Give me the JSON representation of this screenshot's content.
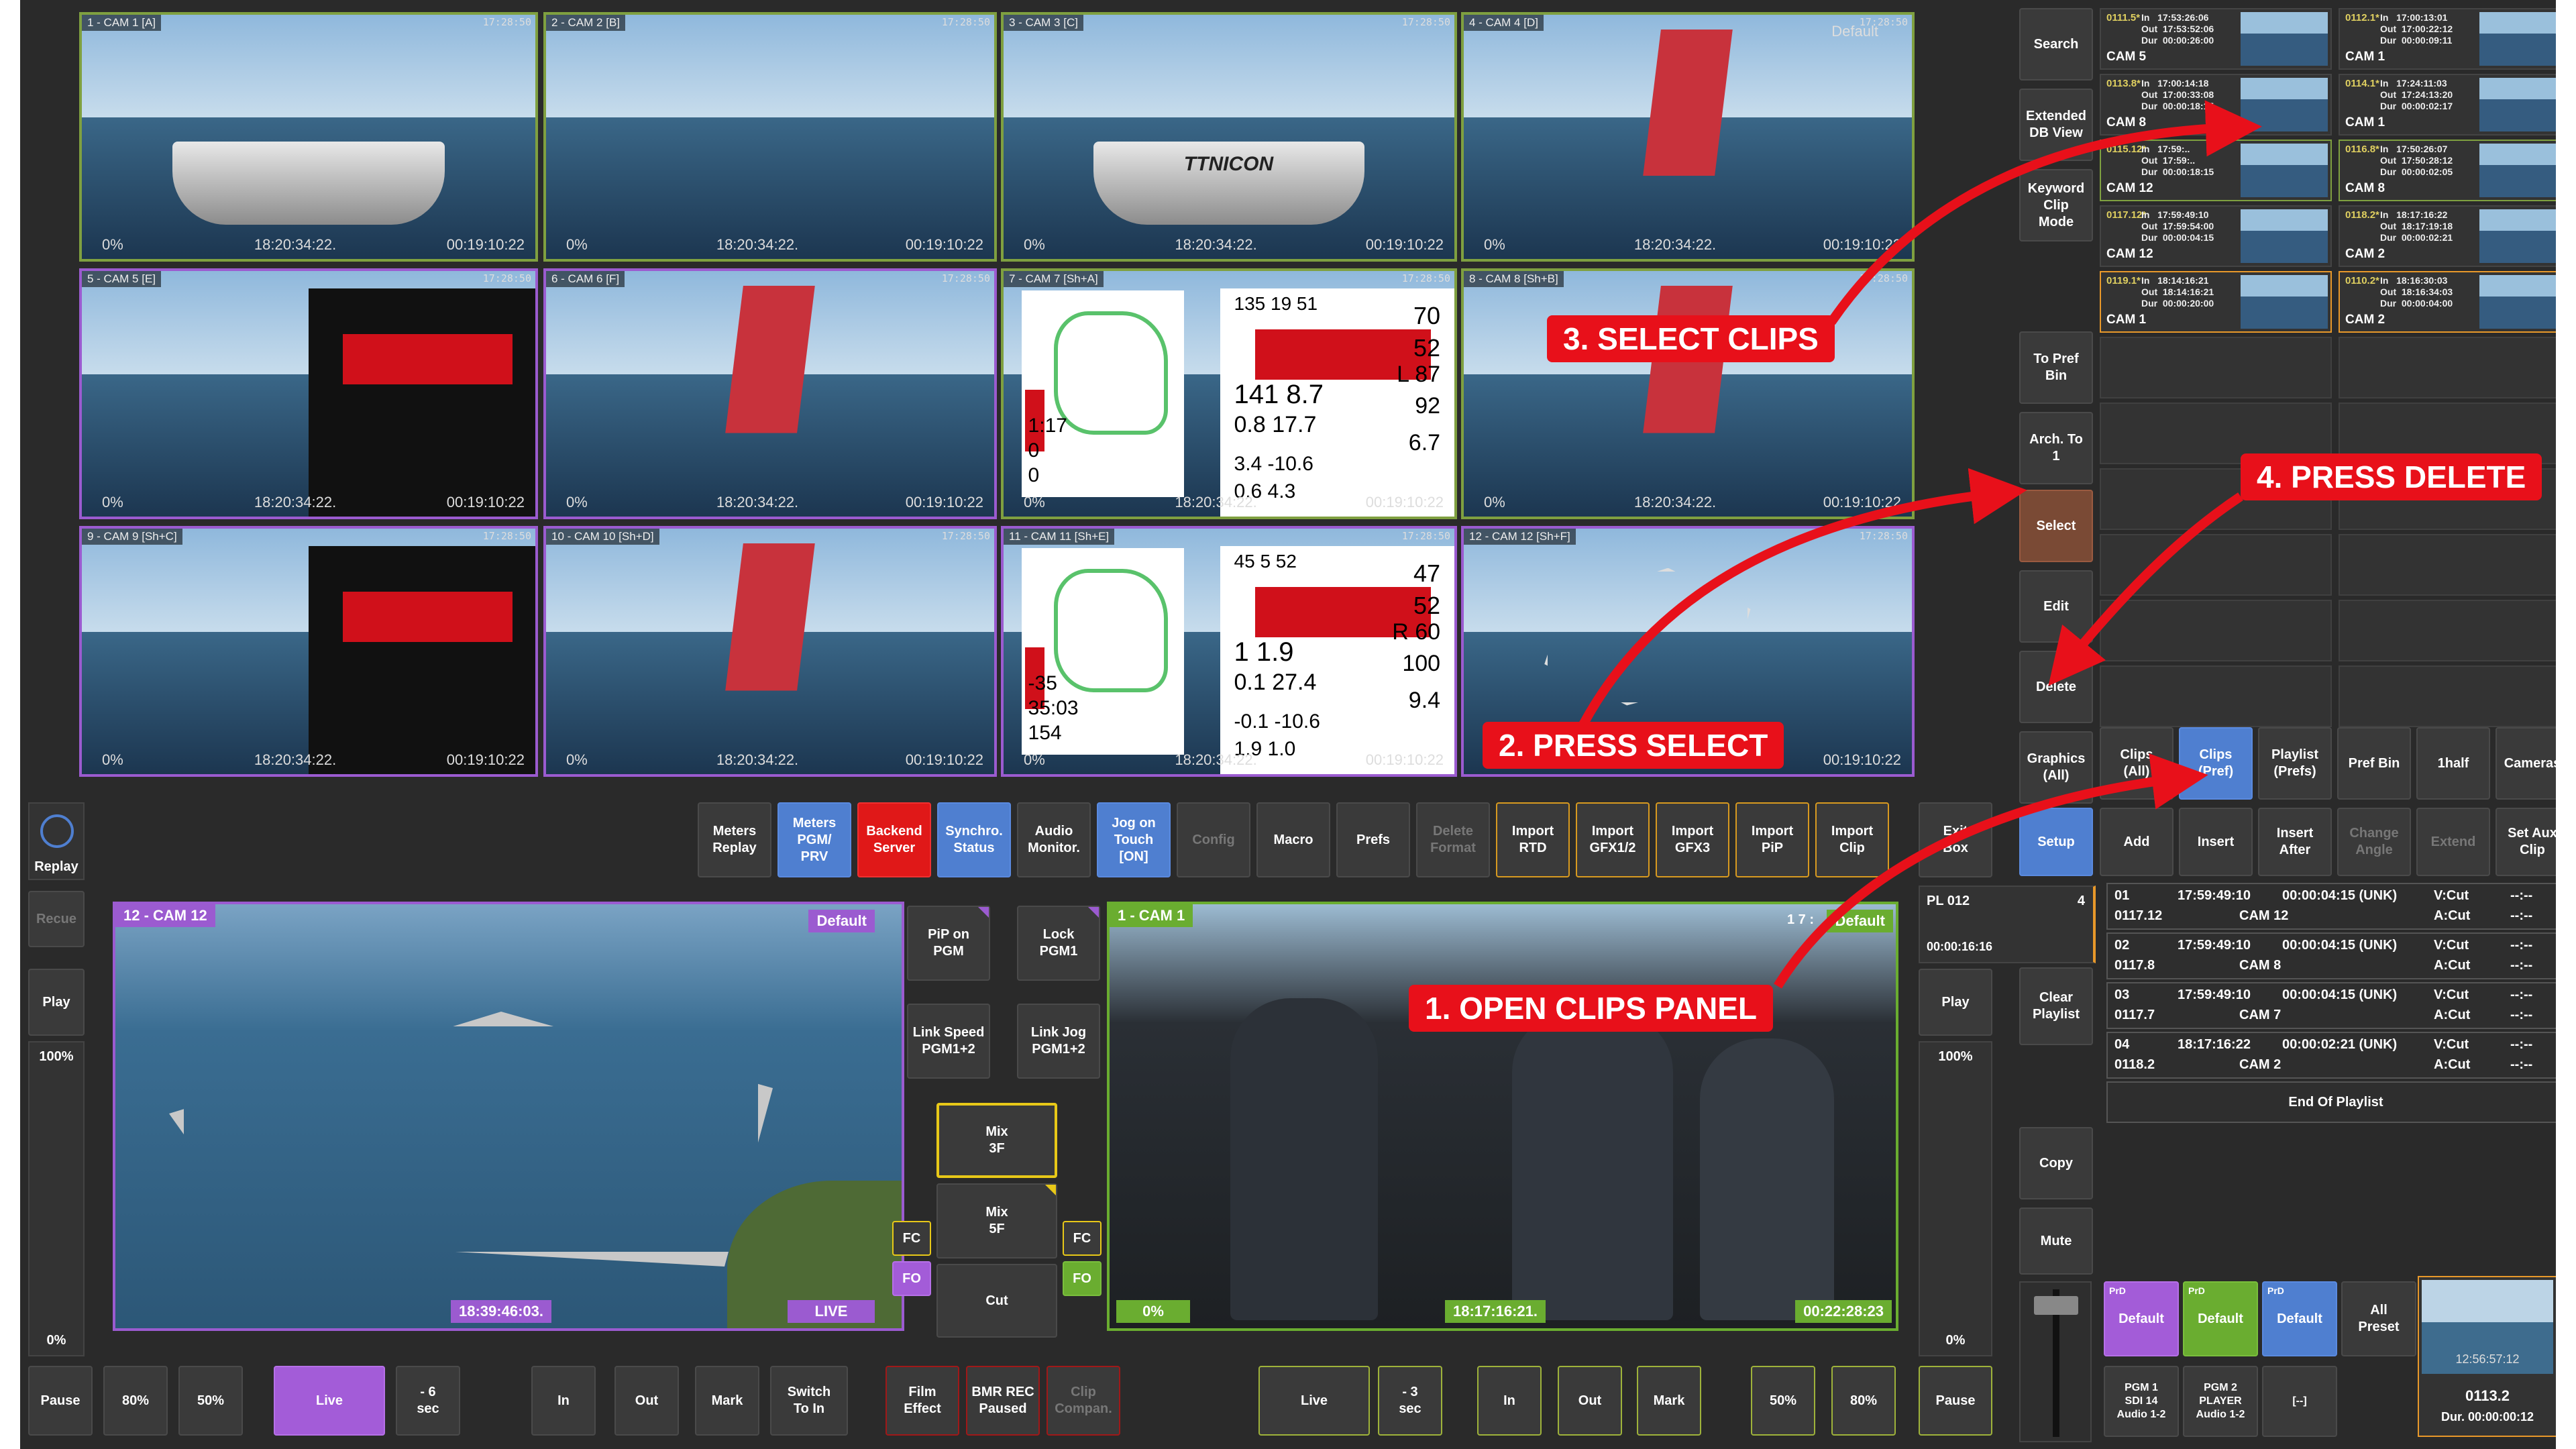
{
  "multiviewer": {
    "tiles": [
      {
        "label": "1 - CAM 1 [A]",
        "tc": "17:28:50",
        "pct": "0%",
        "time": "18:20:34:22.",
        "dur": "00:19:10:22"
      },
      {
        "label": "2 - CAM 2 [B]",
        "tc": "17:28:50",
        "pct": "0%",
        "time": "18:20:34:22.",
        "dur": "00:19:10:22"
      },
      {
        "label": "3 - CAM 3 [C]",
        "tc": "17:28:50",
        "pct": "0%",
        "time": "18:20:34:22.",
        "dur": "00:19:10:22",
        "overlay": "TTNICON"
      },
      {
        "label": "4 - CAM 4 [D]",
        "tc": "17:28:50",
        "pct": "0%",
        "time": "18:20:34:22.",
        "dur": "00:19:10:22",
        "overlay": "Default"
      },
      {
        "label": "5 - CAM 5 [E]",
        "tc": "17:28:50",
        "pct": "0%",
        "time": "18:20:34:22.",
        "dur": "00:19:10:22"
      },
      {
        "label": "6 - CAM 6 [F]",
        "tc": "17:28:50",
        "pct": "0%",
        "time": "18:20:34:22.",
        "dur": "00:19:10:22"
      },
      {
        "label": "7 - CAM 7 [Sh+A]",
        "tc": "17:28:50",
        "pct": "0%",
        "time": "18:20:34:22.",
        "dur": "00:19:10:22"
      },
      {
        "label": "8 - CAM 8 [Sh+B]",
        "tc": "17:28:50",
        "pct": "0%",
        "time": "18:20:34:22.",
        "dur": "00:19:10:22"
      },
      {
        "label": "9 - CAM 9 [Sh+C]",
        "tc": "17:28:50",
        "pct": "0%",
        "time": "18:20:34:22.",
        "dur": "00:19:10:22"
      },
      {
        "label": "10 - CAM 10 [Sh+D]",
        "tc": "17:28:50",
        "pct": "0%",
        "time": "18:20:34:22.",
        "dur": "00:19:10:22"
      },
      {
        "label": "11 - CAM 11 [Sh+E]",
        "tc": "17:28:50",
        "pct": "0%",
        "time": "18:20:34:22.",
        "dur": "00:19:10:22"
      },
      {
        "label": "12 - CAM 12 [Sh+F]",
        "tc": "17:28:50",
        "pct": "0%",
        "time": "18:20:34:22.",
        "dur": "00:19:10:22"
      }
    ],
    "stats7": {
      "top": "135  19  51",
      "v1": "70",
      "v2": "52",
      "v3": "L 87",
      "big": "141  8.7",
      "v4": "92",
      "m1": "0.8  17.7",
      "v5": "6.7",
      "m2": "3.4  -10.6",
      "m3": "0.6  4.3",
      "left1": "1:17",
      "left2": "0",
      "left3": "0"
    },
    "stats11": {
      "top": "45  5  52",
      "v1": "47",
      "v2": "52",
      "v3": "R 60",
      "big": "1  1.9",
      "v4": "100",
      "m1": "0.1  27.4",
      "v5": "9.4",
      "m2": "-0.1  -10.6",
      "m3": "1.9  1.0",
      "left1": "-35",
      "left2": "35:03",
      "left3": "154"
    }
  },
  "left_panel": {
    "replay": "Replay",
    "recue": "Recue",
    "play": "Play",
    "speed": "100%",
    "zero": "0%"
  },
  "top_buttons": [
    {
      "label": "Meters\nReplay",
      "style": ""
    },
    {
      "label": "Meters\nPGM/\nPRV",
      "style": "blue"
    },
    {
      "label": "Backend\nServer",
      "style": "red"
    },
    {
      "label": "Synchro.\nStatus",
      "style": "blue"
    },
    {
      "label": "Audio\nMonitor.",
      "style": ""
    },
    {
      "label": "Jog on\nTouch\n[ON]",
      "style": "blue"
    },
    {
      "label": "Config",
      "style": "dim"
    },
    {
      "label": "Macro",
      "style": ""
    },
    {
      "label": "Prefs",
      "style": ""
    },
    {
      "label": "Delete\nFormat",
      "style": "dim"
    },
    {
      "label": "Import\nRTD",
      "style": "amber"
    },
    {
      "label": "Import\nGFX1/2",
      "style": "amber"
    },
    {
      "label": "Import\nGFX3",
      "style": "amber"
    },
    {
      "label": "Import\nPiP",
      "style": "amber"
    },
    {
      "label": "Import\nClip",
      "style": "amber"
    }
  ],
  "player_a": {
    "title": "12 - CAM 12",
    "preset": "Default",
    "tc": "18:39:46:03.",
    "state": "LIVE"
  },
  "player_b": {
    "title": "1 - CAM 1",
    "preset": "Default",
    "tc_small": "1 7 :",
    "pct": "0%",
    "tc": "18:17:16:21.",
    "dur": "00:22:28:23"
  },
  "center_buttons": {
    "pip": "PiP on\nPGM",
    "lock": "Lock\nPGM1",
    "linkspeed": "Link Speed\nPGM1+2",
    "linkjog": "Link Jog\nPGM1+2",
    "mix3": "Mix\n3F",
    "mix5": "Mix\n5F",
    "cut": "Cut",
    "fc": "FC",
    "fo": "FO"
  },
  "bottom_left": [
    {
      "label": "Pause"
    },
    {
      "label": "80%"
    },
    {
      "label": "50%"
    },
    {
      "label": "Live",
      "style": "purple"
    },
    {
      "label": "- 6\nsec"
    },
    {
      "label": "In"
    },
    {
      "label": "Out"
    },
    {
      "label": "Mark"
    },
    {
      "label": "Switch\nTo In"
    }
  ],
  "bottom_mid": [
    {
      "label": "Film\nEffect"
    },
    {
      "label": "BMR REC\nPaused"
    },
    {
      "label": "Clip\nCompan."
    }
  ],
  "bottom_right": [
    {
      "label": "Live"
    },
    {
      "label": "- 3\nsec"
    },
    {
      "label": "In"
    },
    {
      "label": "Out"
    },
    {
      "label": "Mark"
    },
    {
      "label": "50%"
    },
    {
      "label": "80%"
    },
    {
      "label": "Pause"
    }
  ],
  "right_col": {
    "exit": "Exit\nBox",
    "pl": "PL 012",
    "pl_count": "4",
    "pl_dur": "00:00:16:16",
    "play": "Play",
    "speed": "100%",
    "zero": "0%"
  },
  "side_buttons": [
    {
      "label": "Search"
    },
    {
      "label": "Extended\nDB View"
    },
    {
      "label": "Keyword\nClip\nMode"
    },
    {
      "label": "To Pref\nBin"
    },
    {
      "label": "Arch. To\n1"
    },
    {
      "label": "Select",
      "style": "brown"
    },
    {
      "label": "Edit"
    },
    {
      "label": "Delete"
    },
    {
      "label": "Graphics\n(All)"
    },
    {
      "label": "Setup",
      "style": "blue"
    },
    {
      "label": "Clear\nPlaylist"
    },
    {
      "label": "Copy"
    },
    {
      "label": "Mute"
    }
  ],
  "clips": [
    {
      "id": "0111.5*",
      "io": "In   17:53:26:06\nOut  17:53:52:06\nDur  00:00:26:00",
      "cam": "CAM 5"
    },
    {
      "id": "0112.1*",
      "io": "In   17:00:13:01\nOut  17:00:22:12\nDur  00:00:09:11",
      "cam": "CAM 1"
    },
    {
      "id": "0113.8*",
      "io": "In   17:00:14:18\nOut  17:00:33:08\nDur  00:00:18:15",
      "cam": "CAM 8"
    },
    {
      "id": "0114.1*",
      "io": "In   17:24:11:03\nOut  17:24:13:20\nDur  00:00:02:17",
      "cam": "CAM 1"
    },
    {
      "id": "0115.12*",
      "io": "In   17:59:..\nOut  17:59:..\nDur  00:00:18:15",
      "cam": "CAM 12"
    },
    {
      "id": "0116.8*",
      "io": "In   17:50:26:07\nOut  17:50:28:12\nDur  00:00:02:05",
      "cam": "CAM 8"
    },
    {
      "id": "0117.12*",
      "io": "In   17:59:49:10\nOut  17:59:54:00\nDur  00:00:04:15",
      "cam": "CAM 12"
    },
    {
      "id": "0118.2*",
      "io": "In   18:17:16:22\nOut  18:17:19:18\nDur  00:00:02:21",
      "cam": "CAM 2"
    },
    {
      "id": "0119.1*",
      "io": "In   18:14:16:21\nOut  18:14:16:21\nDur  00:00:20:00",
      "cam": "CAM 1"
    },
    {
      "id": "0110.2*",
      "io": "In   18:16:30:03\nOut  18:16:34:03\nDur  00:00:04:00",
      "cam": "CAM 2"
    }
  ],
  "tabs": [
    {
      "label": "Clips\n(All)"
    },
    {
      "label": "Clips\n(Pref)",
      "style": "blue"
    },
    {
      "label": "Playlist\n(Prefs)"
    },
    {
      "label": "Pref Bin"
    },
    {
      "label": "1half"
    },
    {
      "label": "Cameras"
    }
  ],
  "actions": [
    {
      "label": "Add"
    },
    {
      "label": "Insert"
    },
    {
      "label": "Insert\nAfter"
    },
    {
      "label": "Change\nAngle",
      "style": "dim"
    },
    {
      "label": "Extend",
      "style": "dim"
    },
    {
      "label": "Set Aux\nClip"
    }
  ],
  "playlist": [
    {
      "num": "01",
      "clip": "0117.12",
      "time": "17:59:49:10",
      "dur": "00:00:04:15 (UNK)",
      "cam": "CAM 12",
      "v": "V:Cut",
      "a": "A:Cut",
      "x": "--:--"
    },
    {
      "num": "02",
      "clip": "0117.8",
      "time": "17:59:49:10",
      "dur": "00:00:04:15 (UNK)",
      "cam": "CAM 8",
      "v": "V:Cut",
      "a": "A:Cut",
      "x": "--:--"
    },
    {
      "num": "03",
      "clip": "0117.7",
      "time": "17:59:49:10",
      "dur": "00:00:04:15 (UNK)",
      "cam": "CAM 7",
      "v": "V:Cut",
      "a": "A:Cut",
      "x": "--:--"
    },
    {
      "num": "04",
      "clip": "0118.2",
      "time": "18:17:16:22",
      "dur": "00:00:02:21 (UNK)",
      "cam": "CAM 2",
      "v": "V:Cut",
      "a": "A:Cut",
      "x": "--:--"
    }
  ],
  "end_of_playlist": "End Of Playlist",
  "presets": [
    {
      "tag": "PrD",
      "label": "Default",
      "style": "purple"
    },
    {
      "tag": "PrD",
      "label": "Default",
      "style": "green"
    },
    {
      "tag": "PrD",
      "label": "Default",
      "style": "blue"
    },
    {
      "tag": "",
      "label": "All\nPreset",
      "style": ""
    }
  ],
  "outputs": [
    {
      "label": "PGM 1\nSDI 14\nAudio 1-2"
    },
    {
      "label": "PGM 2\nPLAYER\nAudio 1-2"
    },
    {
      "label": "[--]"
    }
  ],
  "preview": {
    "tc": "12:56:57:12",
    "clip": "0113.2",
    "dur": "Dur. 00:00:00:12"
  },
  "annotations": {
    "a1": "1. OPEN CLIPS PANEL",
    "a2": "2. PRESS SELECT",
    "a3": "3. SELECT CLIPS",
    "a4": "4. PRESS DELETE"
  },
  "colors": {
    "annotation": "#e8101a",
    "purple_border": "#9b5bd0",
    "green_border": "#7fa040",
    "accent_blue": "#4f7fd0"
  }
}
